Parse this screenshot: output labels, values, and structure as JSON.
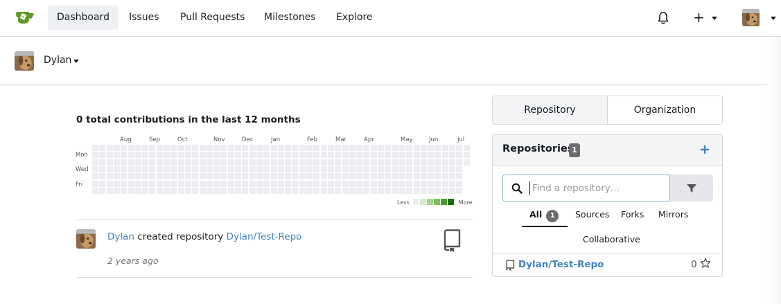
{
  "nav": {
    "items": [
      "Dashboard",
      "Issues",
      "Pull Requests",
      "Milestones",
      "Explore"
    ],
    "plus_label": "+"
  },
  "context": {
    "name": "Dylan"
  },
  "heatmap": {
    "title": "0 total contributions in the last 12 months",
    "months": [
      "Aug",
      "Sep",
      "Oct",
      "Nov",
      "Dec",
      "Jan",
      "Feb",
      "Mar",
      "Apr",
      "May",
      "Jun",
      "Jul"
    ],
    "days": [
      "Mon",
      "Wed",
      "Fri"
    ],
    "legend_less": "Less",
    "legend_more": "More",
    "legend_colors": [
      "#ebedf0",
      "#d7ebcc",
      "#a5d68b",
      "#7cbf5b",
      "#4a9a2f",
      "#1f6b12"
    ],
    "empty_color": "#ebedf0",
    "total_contributions": 0
  },
  "feed": {
    "actor": "Dylan",
    "action": "created repository",
    "target": "Dylan/Test-Repo",
    "time": "2 years ago"
  },
  "panel": {
    "tabs": [
      "Repository",
      "Organization"
    ],
    "title": "Repositories",
    "count": "1",
    "search_placeholder": "Find a repository…",
    "filters": {
      "all": "All",
      "all_count": "1",
      "sources": "Sources",
      "forks": "Forks",
      "mirrors": "Mirrors",
      "collaborative": "Collaborative"
    },
    "repos": [
      {
        "name": "Dylan/Test-Repo",
        "stars": "0"
      }
    ]
  },
  "colors": {
    "accent": "#4183c4",
    "logo_green": "#609926"
  }
}
